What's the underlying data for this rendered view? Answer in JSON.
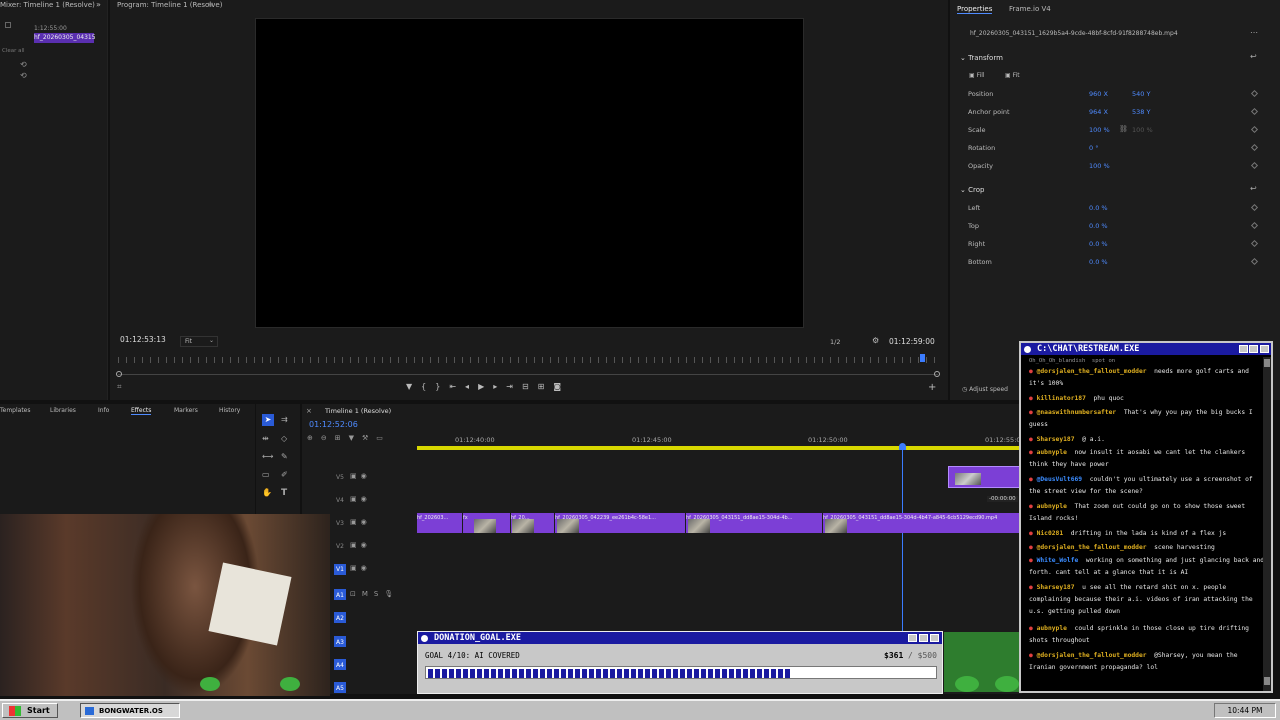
{
  "mixer": {
    "tab": "Mixer: Timeline 1 (Resolve)",
    "timecode": "1:12:55:00",
    "clip_label": "hf_20260305_04315",
    "clear_all": "Clear all"
  },
  "program": {
    "tab": "Program: Timeline 1 (Resolve)",
    "timecode_in": "01:12:53:13",
    "fit": "Fit",
    "resolution": "1/2",
    "timecode_out": "01:12:59:00"
  },
  "properties": {
    "tab_properties": "Properties",
    "tab_frameio": "Frame.io V4",
    "file_name": "hf_20260305_043151_1629b5a4-9cde-48bf-8cfd-91f8288748eb.mp4",
    "transform": "Transform",
    "fill": "Fill",
    "fit": "Fit",
    "position": "Position",
    "position_x": "960 X",
    "position_y": "540 Y",
    "anchor": "Anchor point",
    "anchor_x": "964 X",
    "anchor_y": "538 Y",
    "scale": "Scale",
    "scale_v": "100 %",
    "scale_v2": "100 %",
    "rotation": "Rotation",
    "rotation_v": "0 °",
    "opacity": "Opacity",
    "opacity_v": "100 %",
    "crop": "Crop",
    "left": "Left",
    "left_v": "0.0 %",
    "top": "Top",
    "top_v": "0.0 %",
    "right": "Right",
    "right_v": "0.0 %",
    "bottom": "Bottom",
    "bottom_v": "0.0 %",
    "adjust_speed": "Adjust speed"
  },
  "effects_tabs": [
    "Templates",
    "Libraries",
    "Info",
    "Effects",
    "Markers",
    "History"
  ],
  "timeline": {
    "tab": "Timeline 1 (Resolve)",
    "playhead_time": "01:12:52:06",
    "ruler": [
      "01:12:40:00",
      "01:12:45:00",
      "01:12:50:00",
      "01:12:55:00"
    ],
    "tracks": [
      "V5",
      "V4",
      "V3",
      "V2",
      "V1",
      "A1",
      "A2",
      "A3",
      "A4",
      "A5"
    ],
    "clip_labels": [
      "hf_202603...",
      "fx",
      "hf_20...",
      "hf_20260305_042239_ee261b4c-58e1...",
      "hf_20260305_043151_dd8ae15-304d-4b...",
      "hf_20260305_043151_dd8ae15-304d-4b47-a845-6cb5129ecd90.mp4"
    ],
    "offset_label": "-00:00:00"
  },
  "chat": {
    "title": "C:\\CHAT\\RESTREAM.EXE",
    "top_cut": "Oh_Oh_Oh_blandish  spot on",
    "messages": [
      {
        "user": "@dorsjalen_the_fallout_modder",
        "text": "needs more golf carts and it's 100%",
        "color": "yellow"
      },
      {
        "user": "killinator187",
        "text": "phu quoc",
        "color": "yellow"
      },
      {
        "user": "@naaswithnumbersafter",
        "text": "That's why you pay the big bucks I guess",
        "color": "yellow"
      },
      {
        "user": "Sharsey187",
        "text": "@ a.i.",
        "color": "yellow"
      },
      {
        "user": "aubnyple",
        "text": "now insult it aosabi we cant let the clankers think they have power",
        "color": "yellow"
      },
      {
        "user": "@DeusVult669",
        "text": "couldn't you ultimately use a screenshot of the street view for the scene?",
        "color": "blue"
      },
      {
        "user": "aubnyple",
        "text": "That zoom out could go on to show those sweet Island rocks!",
        "color": "yellow"
      },
      {
        "user": "Nic0281",
        "text": "drifting in the lada is kind of a flex js",
        "color": "yellow"
      },
      {
        "user": "@dorsjalen_the_fallout_modder",
        "text": "scene harvesting",
        "color": "yellow"
      },
      {
        "user": "White_Wolfe",
        "text": "working on something and just glancing back and forth. cant tell at a glance that it is AI",
        "color": "blue"
      },
      {
        "user": "Sharsey187",
        "text": "u see all the retard shit on x. people complaining because their a.i. videos of iran attacking the u.s. getting pulled down",
        "color": "yellow"
      },
      {
        "user": "aubnyple",
        "text": "could sprinkle in those close up tire drifting shots throughout",
        "color": "yellow"
      },
      {
        "user": "@dorsjalen_the_fallout_modder",
        "text": "@Sharsey, you mean the Iranian government propaganda? lol",
        "color": "yellow"
      }
    ]
  },
  "donation": {
    "title": "DONATION_GOAL.EXE",
    "goal_label": "GOAL 4/10: AI COVERED",
    "amount": "$361",
    "target": "/ $500",
    "progress": 0.722
  },
  "taskbar": {
    "start": "Start",
    "task": "BONGWATER.OS",
    "clock": "10:44 PM"
  },
  "colors": {
    "clip": "#7c3fd6",
    "win_title": "#1a1aa0",
    "accent_blue": "#4f8bff"
  }
}
